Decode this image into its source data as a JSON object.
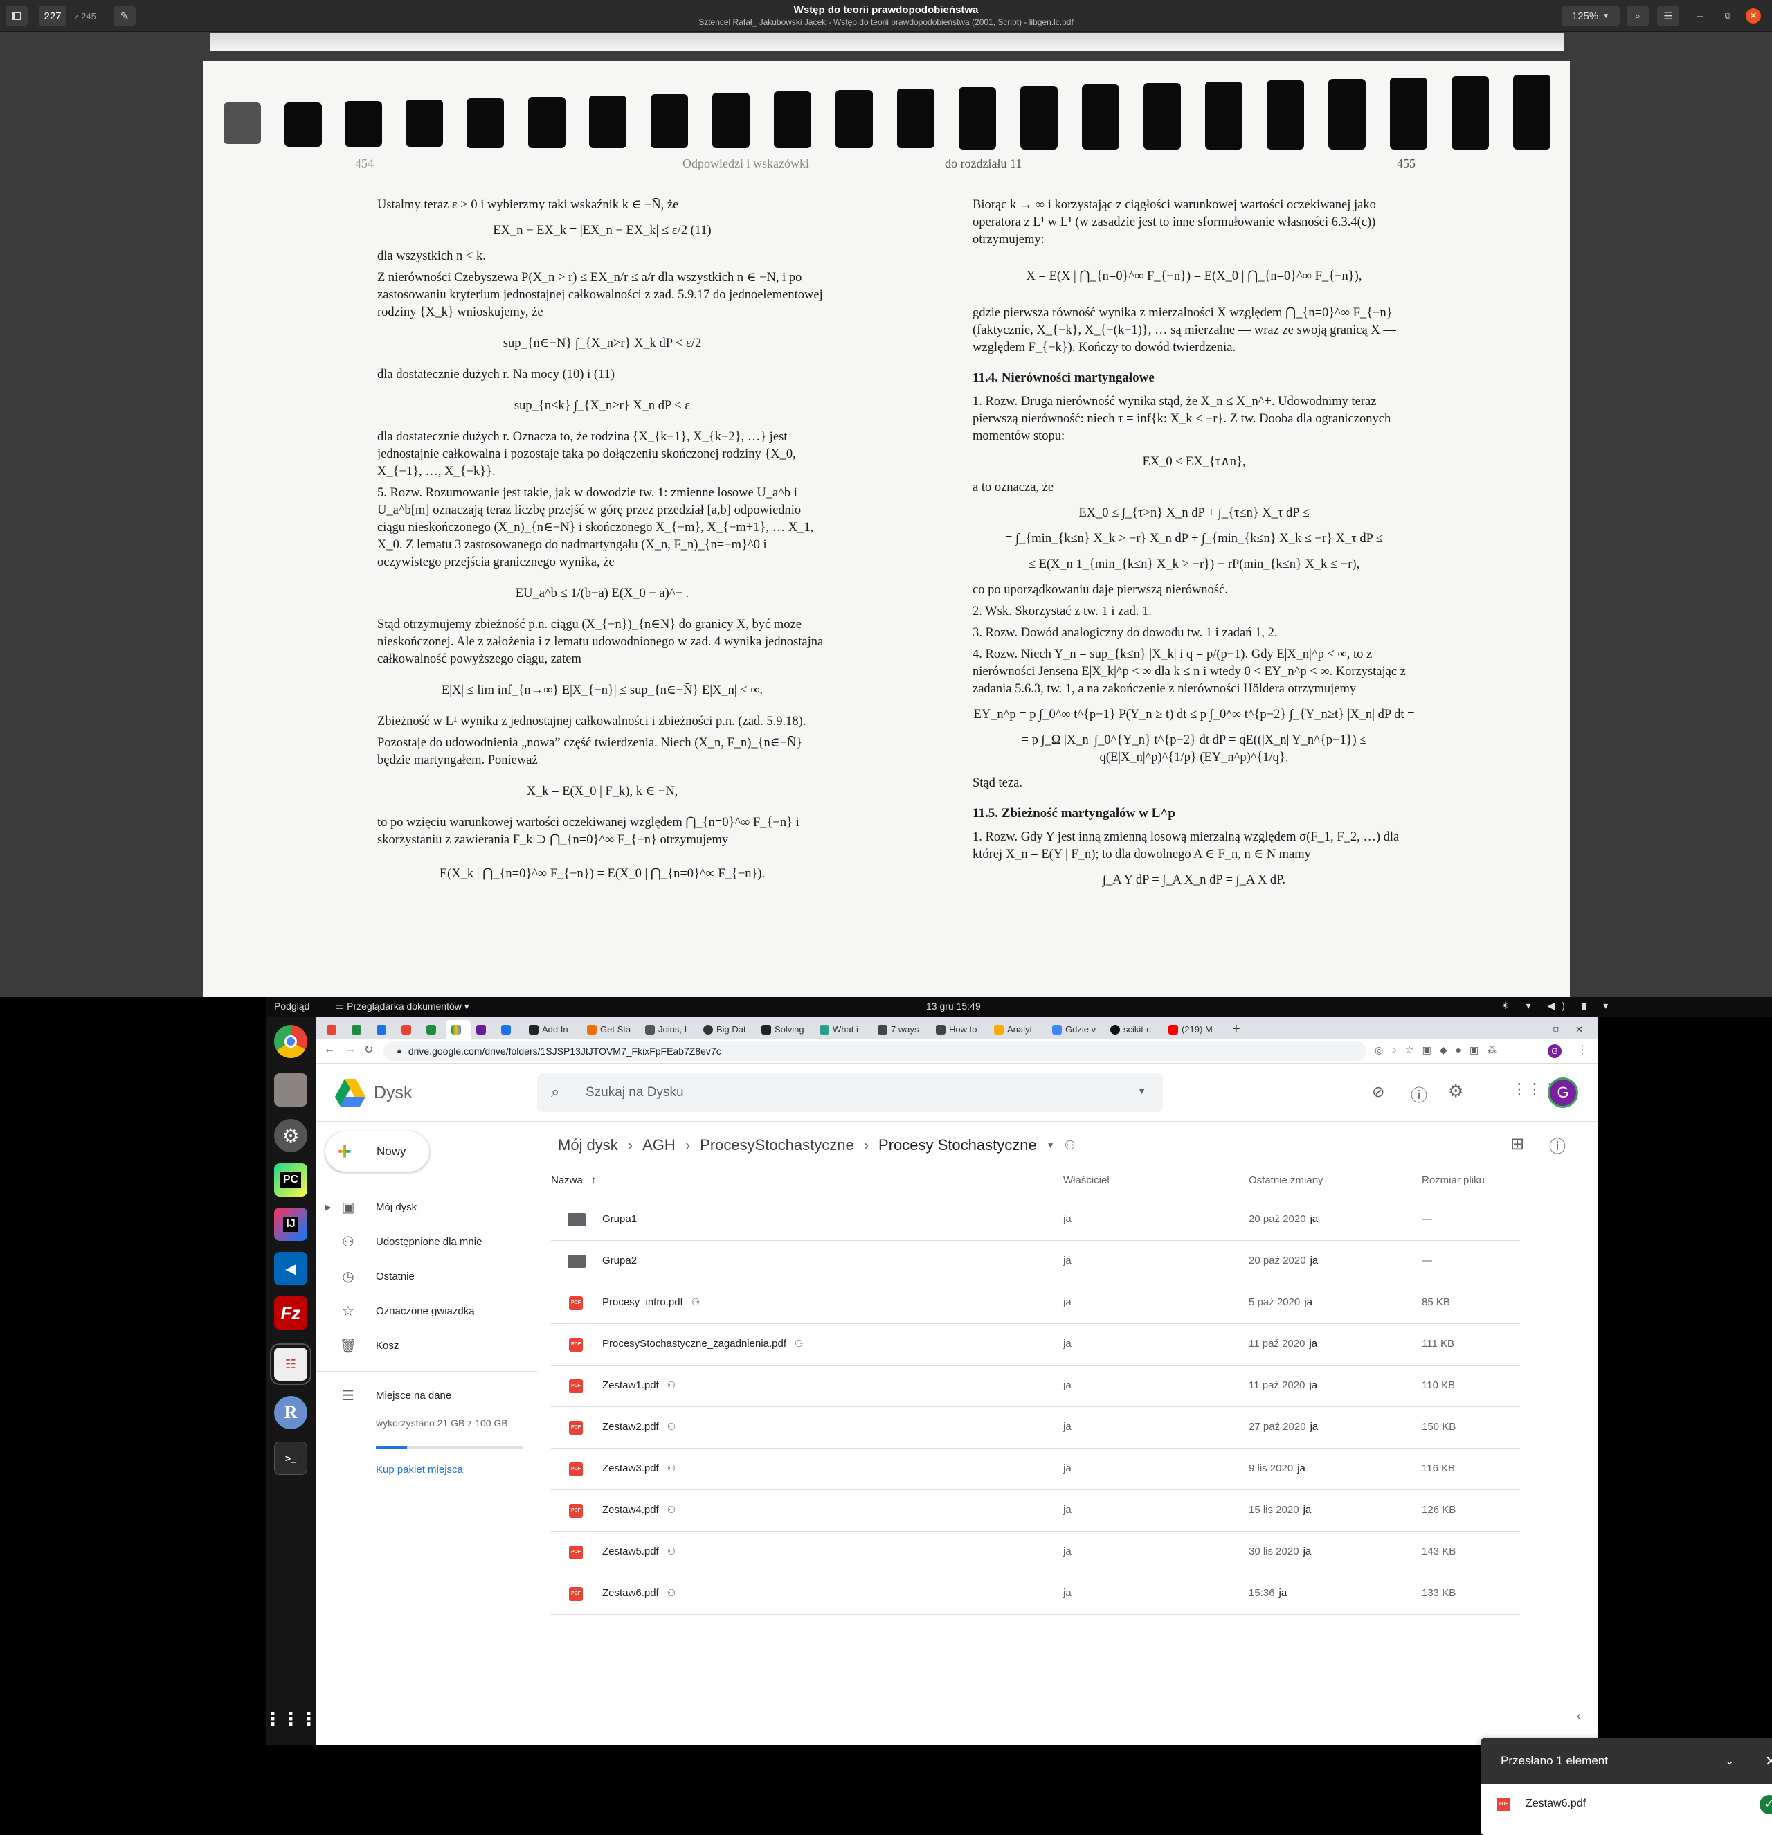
{
  "viewer": {
    "page_num": "227",
    "page_total": "z 245",
    "title": "Wstęp do teorii prawdopodobieństwa",
    "subtitle": "Sztencel Rafał_ Jakubowski Jacek - Wstęp do teorii prawdopodobieństwa (2001, Script) - libgen.lc.pdf",
    "zoom": "125%"
  },
  "book": {
    "left_header_num": "454",
    "left_header": "Odpowiedzi i wskazówki",
    "right_header": "do rozdziału 11",
    "right_header_num": "455",
    "left": [
      "Ustalmy teraz ε > 0 i wybierzmy taki wskaźnik k ∈ −N̄, że",
      "EX_n − EX_k = |EX_n − EX_k| ≤ ε/2                (11)",
      "dla wszystkich n < k.",
      "Z nierówności Czebyszewa P(X_n > r) ≤ EX_n/r ≤ a/r dla wszystkich n ∈ −N̄, i po zastosowaniu kryterium jednostajnej całkowalności z zad. 5.9.17 do jednoelementowej rodziny {X_k} wnioskujemy, że",
      "sup_{n∈−N̄} ∫_{X_n>r} X_k dP < ε/2",
      "dla dostatecznie dużych r. Na mocy (10) i (11)",
      "sup_{n<k} ∫_{X_n>r} X_n dP < ε",
      "dla dostatecznie dużych r. Oznacza to, że rodzina {X_{k−1}, X_{k−2}, …} jest jednostajnie całkowalna i pozostaje taka po dołączeniu skończonej rodziny {X_0, X_{−1}, …, X_{−k}}.",
      "5. Rozw. Rozumowanie jest takie, jak w dowodzie tw. 1: zmienne losowe U_a^b i U_a^b[m] oznaczają teraz liczbę przejść w górę przez przedział [a,b] odpowiednio ciągu nieskończonego (X_n)_{n∈−N̄} i skończonego X_{−m}, X_{−m+1}, … X_1, X_0. Z lematu 3 zastosowanego do nadmartyngału (X_n, F_n)_{n=−m}^0 i oczywistego przejścia granicznego wynika, że",
      "EU_a^b ≤ 1/(b−a) E(X_0 − a)^− .",
      "Stąd otrzymujemy zbieżność p.n. ciągu (X_{−n})_{n∈N} do granicy X, być może nieskończonej. Ale z założenia i z lematu udowodnionego w zad. 4 wynika jednostajna całkowalność powyższego ciągu, zatem",
      "E|X| ≤ lim inf_{n→∞} E|X_{−n}| ≤ sup_{n∈−N̄} E|X_n| < ∞.",
      "Zbieżność w L¹ wynika z jednostajnej całkowalności i zbieżności p.n. (zad. 5.9.18).",
      "Pozostaje do udowodnienia „nowa” część twierdzenia. Niech (X_n, F_n)_{n∈−N̄} będzie martyngałem. Ponieważ",
      "X_k = E(X_0 | F_k),   k ∈ −N̄,",
      "to po wzięciu warunkowej wartości oczekiwanej względem ⋂_{n=0}^∞ F_{−n} i skorzystaniu z zawierania F_k ⊃ ⋂_{n=0}^∞ F_{−n} otrzymujemy",
      "E(X_k | ⋂_{n=0}^∞ F_{−n}) = E(X_0 | ⋂_{n=0}^∞ F_{−n})."
    ],
    "right": [
      "Biorąc k → ∞ i korzystając z ciągłości warunkowej wartości oczekiwanej jako operatora z L¹ w L¹ (w zasadzie jest to inne sformułowanie własności 6.3.4(c)) otrzymujemy:",
      "X = E(X | ⋂_{n=0}^∞ F_{−n}) = E(X_0 | ⋂_{n=0}^∞ F_{−n}),",
      "gdzie pierwsza równość wynika z mierzalności X względem ⋂_{n=0}^∞ F_{−n} (faktycznie, X_{−k}, X_{−(k−1)}, … są mierzalne — wraz ze swoją granicą X — względem F_{−k}). Kończy to dowód twierdzenia.",
      "11.4. Nierówności martyngałowe",
      "1. Rozw. Druga nierówność wynika stąd, że X_n ≤ X_n^+. Udowodnimy teraz pierwszą nierówność: niech τ = inf{k: X_k ≤ −r}. Z tw. Dooba dla ograniczonych momentów stopu:",
      "EX_0 ≤ EX_{τ∧n},",
      "a to oznacza, że",
      "EX_0 ≤ ∫_{τ>n} X_n dP + ∫_{τ≤n} X_τ dP ≤",
      "= ∫_{min_{k≤n} X_k > −r} X_n dP + ∫_{min_{k≤n} X_k ≤ −r} X_τ dP ≤",
      "≤ E(X_n 1_{min_{k≤n} X_k > −r}) − rP(min_{k≤n} X_k ≤ −r),",
      "co po uporządkowaniu daje pierwszą nierówność.",
      "2. Wsk. Skorzystać z tw. 1 i zad. 1.",
      "3. Rozw. Dowód analogiczny do dowodu tw. 1 i zadań 1, 2.",
      "4. Rozw. Niech Y_n = sup_{k≤n} |X_k| i q = p/(p−1). Gdy E|X_n|^p < ∞, to z nierówności Jensena E|X_k|^p < ∞ dla k ≤ n i wtedy 0 < EY_n^p < ∞. Korzystając z zadania 5.6.3, tw. 1, a na zakończenie z nierówności Höldera otrzymujemy",
      "EY_n^p = p ∫_0^∞ t^{p−1} P(Y_n ≥ t) dt ≤ p ∫_0^∞ t^{p−2} ∫_{Y_n≥t} |X_n| dP dt =",
      "= p ∫_Ω |X_n| ∫_0^{Y_n} t^{p−2} dt dP = qE((|X_n| Y_n^{p−1}) ≤ q(E|X_n|^p)^{1/p} (EY_n^p)^{1/q}.",
      "Stąd teza.",
      "11.5. Zbieżność martyngałów w L^p",
      "1. Rozw. Gdy Y jest inną zmienną losową mierzalną względem σ(F_1, F_2, …) dla której X_n = E(Y | F_n); to dla dowolnego A ∈ F_n, n ∈ N mamy",
      "∫_A Y dP = ∫_A X_n dP = ∫_A X dP."
    ]
  },
  "desktop": {
    "activities": "Podgląd",
    "app_menu": "Przeglądarka dokumentów",
    "clock": "13 gru  15:49"
  },
  "tabs": [
    "",
    "",
    "",
    "",
    "",
    "",
    "",
    "",
    "Add In",
    "Get Sta",
    "Joins, I",
    "Big Dat",
    "Solving",
    "What i",
    "7 ways",
    "How to",
    "Analyt",
    "Gdzie v",
    "scikit-c",
    "(219) M"
  ],
  "url": "drive.google.com/drive/folders/1SJSP13JtJTOVM7_FkixFpFEab7Z8ev7c",
  "drive": {
    "app_name": "Dysk",
    "search_placeholder": "Szukaj na Dysku",
    "new_button": "Nowy",
    "avatar": "G",
    "nav": [
      "Mój dysk",
      "Udostępnione dla mnie",
      "Ostatnie",
      "Oznaczone gwiazdką",
      "Kosz"
    ],
    "storage_label": "Miejsce na dane",
    "storage_used": "wykorzystano 21 GB z 100 GB",
    "storage_fraction": 0.21,
    "buy_storage": "Kup pakiet miejsca",
    "breadcrumb": [
      "Mój dysk",
      "AGH",
      "ProcesyStochastyczne",
      "Procesy Stochastyczne"
    ],
    "columns": {
      "name": "Nazwa",
      "owner": "Właściciel",
      "modified": "Ostatnie zmiany",
      "size": "Rozmiar pliku"
    },
    "files": [
      {
        "name": "Grupa1",
        "type": "folder",
        "shared": false,
        "owner": "ja",
        "modified": "20 paź 2020",
        "mod_by": "ja",
        "size": "—"
      },
      {
        "name": "Grupa2",
        "type": "folder",
        "shared": false,
        "owner": "ja",
        "modified": "20 paź 2020",
        "mod_by": "ja",
        "size": "—"
      },
      {
        "name": "Procesy_intro.pdf",
        "type": "pdf",
        "shared": true,
        "owner": "ja",
        "modified": "5 paź 2020",
        "mod_by": "ja",
        "size": "85 KB"
      },
      {
        "name": "ProcesyStochastyczne_zagadnienia.pdf",
        "type": "pdf",
        "shared": true,
        "owner": "ja",
        "modified": "11 paź 2020",
        "mod_by": "ja",
        "size": "111 KB"
      },
      {
        "name": "Zestaw1.pdf",
        "type": "pdf",
        "shared": true,
        "owner": "ja",
        "modified": "11 paź 2020",
        "mod_by": "ja",
        "size": "110 KB"
      },
      {
        "name": "Zestaw2.pdf",
        "type": "pdf",
        "shared": true,
        "owner": "ja",
        "modified": "27 paź 2020",
        "mod_by": "ja",
        "size": "150 KB"
      },
      {
        "name": "Zestaw3.pdf",
        "type": "pdf",
        "shared": true,
        "owner": "ja",
        "modified": "9 lis 2020",
        "mod_by": "ja",
        "size": "116 KB"
      },
      {
        "name": "Zestaw4.pdf",
        "type": "pdf",
        "shared": true,
        "owner": "ja",
        "modified": "15 lis 2020",
        "mod_by": "ja",
        "size": "126 KB"
      },
      {
        "name": "Zestaw5.pdf",
        "type": "pdf",
        "shared": true,
        "owner": "ja",
        "modified": "30 lis 2020",
        "mod_by": "ja",
        "size": "143 KB"
      },
      {
        "name": "Zestaw6.pdf",
        "type": "pdf",
        "shared": true,
        "owner": "ja",
        "modified": "15:36",
        "mod_by": "ja",
        "size": "133 KB"
      }
    ],
    "upload": {
      "title": "Przesłano 1 element",
      "file": "Zestaw6.pdf"
    }
  },
  "colors": {
    "drive_blue": "#1a73e8",
    "pdf_red": "#ea4335",
    "upload_green": "#188038"
  }
}
